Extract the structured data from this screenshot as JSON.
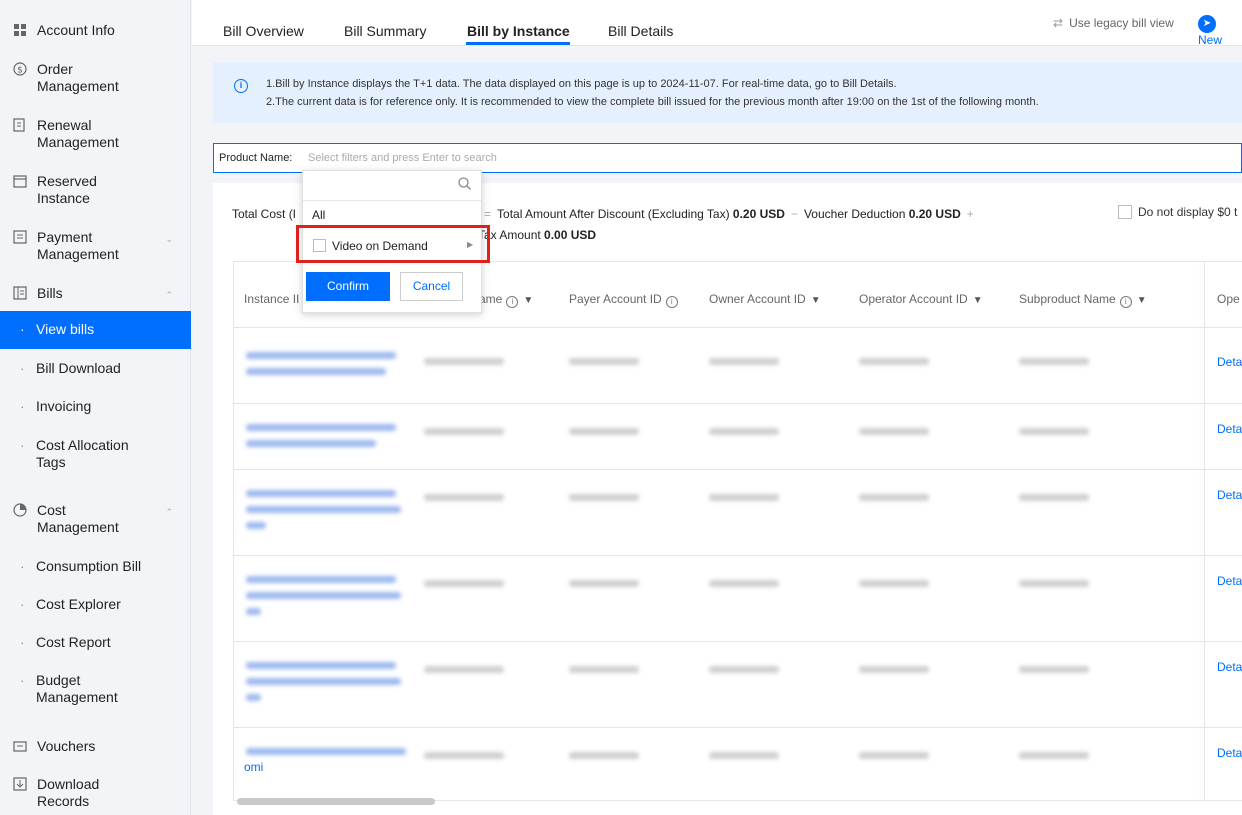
{
  "sidebar": {
    "items": [
      {
        "label": "Account Info",
        "icon": "grid-icon"
      },
      {
        "label": "Order Management",
        "icon": "dollar-circle-icon"
      },
      {
        "label": "Renewal Management",
        "icon": "renew-doc-icon"
      },
      {
        "label": "Reserved Instance",
        "icon": "calendar-icon"
      },
      {
        "label": "Payment Management",
        "icon": "payment-icon"
      },
      {
        "label": "Bills",
        "icon": "bill-icon"
      },
      {
        "label": "Cost Management",
        "icon": "pie-chart-icon"
      },
      {
        "label": "Vouchers",
        "icon": "voucher-icon"
      },
      {
        "label": "Download Records",
        "icon": "download-icon"
      }
    ],
    "bills_sub": [
      "View bills",
      "Bill Download",
      "Invoicing",
      "Cost Allocation Tags"
    ],
    "cost_sub": [
      "Consumption Bill",
      "Cost Explorer",
      "Cost Report",
      "Budget Management"
    ]
  },
  "tabs": [
    "Bill Overview",
    "Bill Summary",
    "Bill by Instance",
    "Bill Details"
  ],
  "header": {
    "legacy": "Use legacy bill view",
    "new": "New"
  },
  "banner": {
    "line1": "1.Bill by Instance displays the T+1 data. The data displayed on this page is up to 2024-11-07. For real-time data, go to Bill Details.",
    "line2": "2.The current data is for reference only. It is recommended to view the complete bill issued for the previous month after 19:00 on the 1st of the following month."
  },
  "filter": {
    "label": "Product Name:",
    "placeholder": "Select filters and press Enter to search"
  },
  "summary": {
    "total_prefix": "Total Cost (I",
    "after_discount_label": "Total Amount After Discount (Excluding Tax)",
    "after_discount_value": "0.20 USD",
    "voucher_label": "Voucher Deduction",
    "voucher_value": "0.20 USD",
    "tax_label": "Tax Amount",
    "tax_value": "0.00 USD",
    "no_zero": "Do not display $0 t"
  },
  "table": {
    "headers": [
      "Instance II",
      "ame",
      "Payer Account ID",
      "Owner Account ID",
      "Operator Account ID",
      "Subproduct Name",
      "Ope"
    ],
    "detail_label": "Deta",
    "last_row_fragment": "omi"
  },
  "dropdown": {
    "all": "All",
    "option": "Video on Demand",
    "confirm": "Confirm",
    "cancel": "Cancel"
  },
  "colors": {
    "accent": "#006eff",
    "highlight": "#e0201b",
    "banner_bg": "#e5f0ff"
  }
}
